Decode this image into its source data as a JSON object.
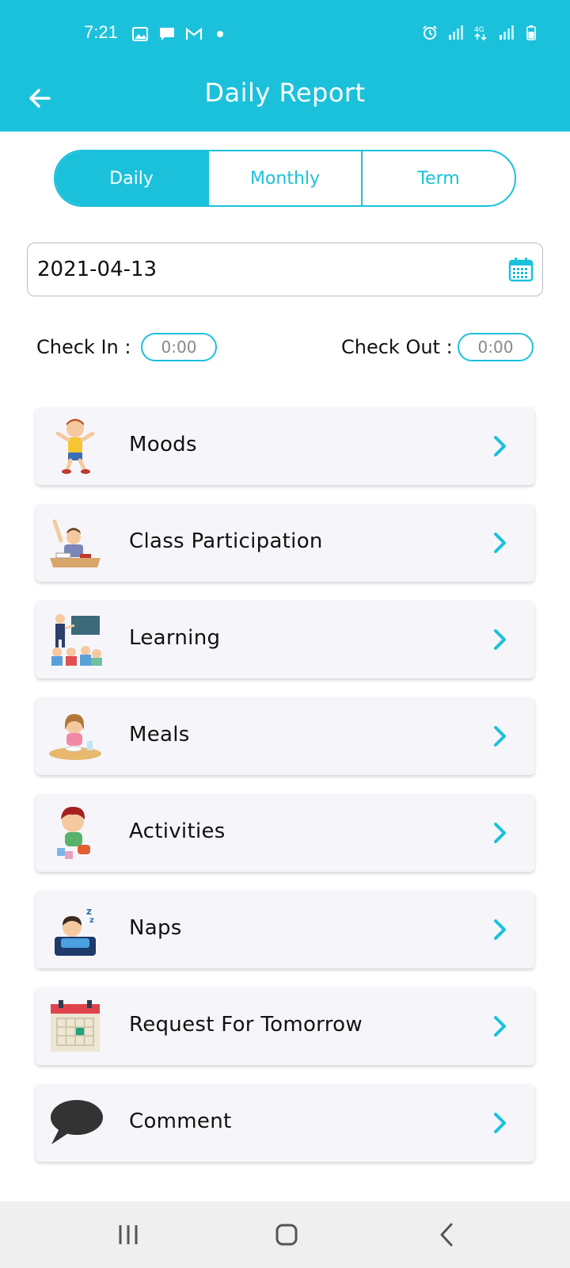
{
  "status": {
    "time": "7:21",
    "network": "4G"
  },
  "appbar": {
    "title": "Daily Report"
  },
  "tabs": [
    {
      "label": "Daily",
      "selected": true
    },
    {
      "label": "Monthly",
      "selected": false
    },
    {
      "label": "Term",
      "selected": false
    }
  ],
  "date": {
    "value": "2021-04-13"
  },
  "check": {
    "in_label": "Check In :",
    "in_value": "0:00",
    "out_label": "Check Out :",
    "out_value": "0:00"
  },
  "items": [
    {
      "label": "Moods",
      "icon": "happy-boy-icon"
    },
    {
      "label": "Class Participation",
      "icon": "raised-hand-student-icon"
    },
    {
      "label": "Learning",
      "icon": "teacher-classroom-icon"
    },
    {
      "label": "Meals",
      "icon": "girl-eating-icon"
    },
    {
      "label": "Activities",
      "icon": "child-playing-icon"
    },
    {
      "label": "Naps",
      "icon": "sleeping-child-icon"
    },
    {
      "label": "Request For Tomorrow",
      "icon": "calendar-icon"
    },
    {
      "label": "Comment",
      "icon": "speech-bubble-icon"
    }
  ],
  "colors": {
    "accent": "#1bc1db",
    "card": "#f6f6fa",
    "navbar": "#efefef"
  }
}
